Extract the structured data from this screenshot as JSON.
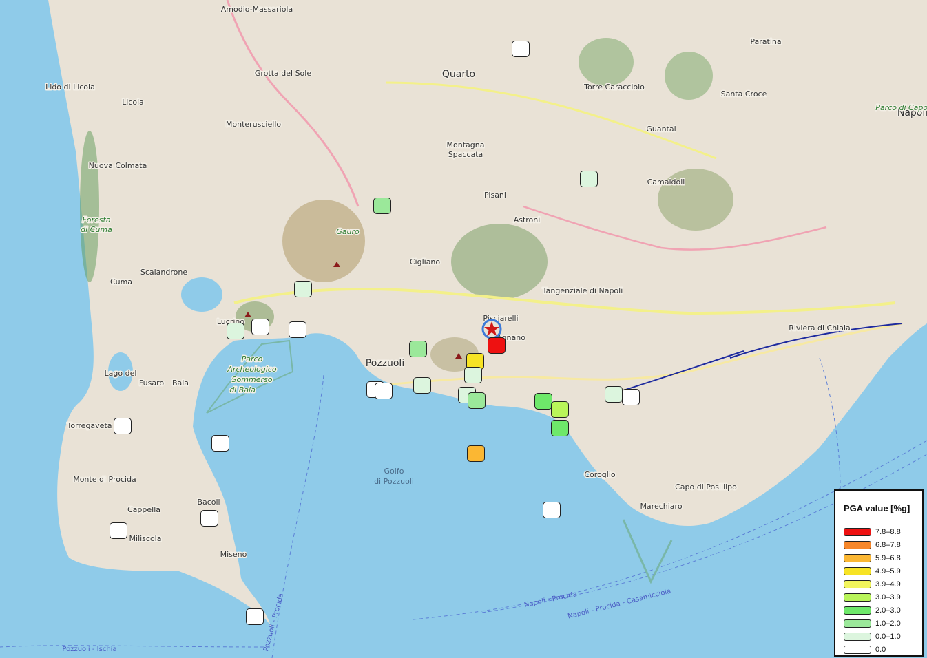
{
  "map": {
    "places": [
      {
        "name": "Amodio-Massariola"
      },
      {
        "name": "Grotta del Sole"
      },
      {
        "name": "Quarto"
      },
      {
        "name": "Paratina"
      },
      {
        "name": "Lido di Licola"
      },
      {
        "name": "Licola"
      },
      {
        "name": "Torre Caracciolo"
      },
      {
        "name": "Santa Croce"
      },
      {
        "name": "Monterusciello"
      },
      {
        "name": "Guantai"
      },
      {
        "name": "Napoli"
      },
      {
        "name": "Montagna"
      },
      {
        "name": "Spaccata"
      },
      {
        "name": "Nuova Colmata"
      },
      {
        "name": "Camaldoli"
      },
      {
        "name": "Pisani"
      },
      {
        "name": "Astroni"
      },
      {
        "name": "Foresta"
      },
      {
        "name": "di Cuma"
      },
      {
        "name": "Gauro"
      },
      {
        "name": "Cigliano"
      },
      {
        "name": "Scalandrone"
      },
      {
        "name": "Cuma"
      },
      {
        "name": "Tangenziale di Napoli"
      },
      {
        "name": "Pisciarelli"
      },
      {
        "name": "Agnano"
      },
      {
        "name": "Lucrino"
      },
      {
        "name": "Pozzuoli"
      },
      {
        "name": "Parco"
      },
      {
        "name": "Archeologico"
      },
      {
        "name": "Sommerso"
      },
      {
        "name": "di Baia"
      },
      {
        "name": "Lago del"
      },
      {
        "name": "Fusaro"
      },
      {
        "name": "Baia"
      },
      {
        "name": "Torregaveta"
      },
      {
        "name": "Monte di Procida"
      },
      {
        "name": "Golfo"
      },
      {
        "name": "di Pozzuoli"
      },
      {
        "name": "Coroglio"
      },
      {
        "name": "Capo di Posillipo"
      },
      {
        "name": "Bacoli"
      },
      {
        "name": "Cappella"
      },
      {
        "name": "Marechiaro"
      },
      {
        "name": "Miliscola"
      },
      {
        "name": "Miseno"
      },
      {
        "name": "Riviera di Chiaia"
      },
      {
        "name": "Parco di Capodimonte"
      }
    ],
    "ferry_routes": [
      {
        "label": "Napoli - Procida"
      },
      {
        "label": "Napoli - Procida - Casamicciola"
      },
      {
        "label": "Pozzuoli - Ischia"
      },
      {
        "label": "Pozzuoli - Procida"
      }
    ],
    "epicenter_icon": "star-icon",
    "colors": {
      "sea": "#8fcbe9",
      "land": "#e9e2d6"
    }
  },
  "stations": [
    {
      "pga_class": "0.0"
    },
    {
      "pga_class": "0.0-1.0"
    },
    {
      "pga_class": "1.0-2.0"
    },
    {
      "pga_class": "0.0-1.0"
    },
    {
      "pga_class": "0.0"
    },
    {
      "pga_class": "0.0"
    },
    {
      "pga_class": "0.0-1.0"
    },
    {
      "pga_class": "1.0-2.0"
    },
    {
      "pga_class": "7.8-8.8"
    },
    {
      "pga_class": "4.9-5.9"
    },
    {
      "pga_class": "0.0-1.0"
    },
    {
      "pga_class": "0.0"
    },
    {
      "pga_class": "0.0"
    },
    {
      "pga_class": "0.0-1.0"
    },
    {
      "pga_class": "0.0-1.0"
    },
    {
      "pga_class": "1.0-2.0"
    },
    {
      "pga_class": "2.0-3.0"
    },
    {
      "pga_class": "3.0-3.9"
    },
    {
      "pga_class": "2.0-3.0"
    },
    {
      "pga_class": "0.0-1.0"
    },
    {
      "pga_class": "0.0"
    },
    {
      "pga_class": "0.0"
    },
    {
      "pga_class": "0.0"
    },
    {
      "pga_class": "5.9-6.8"
    },
    {
      "pga_class": "0.0"
    },
    {
      "pga_class": "0.0"
    },
    {
      "pga_class": "0.0"
    },
    {
      "pga_class": "0.0"
    }
  ],
  "legend": {
    "title": "PGA value [%g]",
    "items": [
      {
        "label": "7.8–8.8",
        "color": "#ee1111"
      },
      {
        "label": "6.8–7.8",
        "color": "#f7872a"
      },
      {
        "label": "5.9–6.8",
        "color": "#fbb733"
      },
      {
        "label": "4.9–5.9",
        "color": "#f7e324"
      },
      {
        "label": "3.9–4.9",
        "color": "#f2f55c"
      },
      {
        "label": "3.0–3.9",
        "color": "#b9f55a"
      },
      {
        "label": "2.0–3.0",
        "color": "#6ee86a"
      },
      {
        "label": "1.0–2.0",
        "color": "#9be89a"
      },
      {
        "label": "0.0–1.0",
        "color": "#dcf5de"
      },
      {
        "label": "0.0",
        "color": "#ffffff"
      }
    ]
  }
}
